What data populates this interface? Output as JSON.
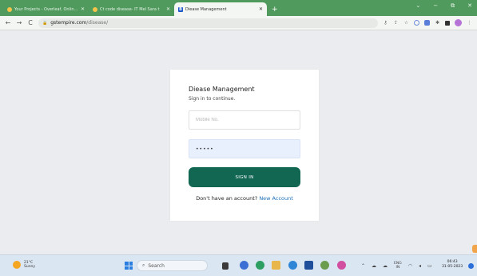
{
  "tabs": [
    {
      "label": "Your Projects - Overleaf, Online L"
    },
    {
      "label": "Ct code disease- IT Mel Sara t"
    },
    {
      "label": "Diease Management"
    }
  ],
  "new_tab_label": "+",
  "window_controls": [
    "⌄",
    "−",
    "⧉",
    "✕"
  ],
  "address": {
    "host": "gstempire.com",
    "path": "/disease/"
  },
  "nav": {
    "back": "←",
    "forward": "→",
    "reload": "C"
  },
  "card": {
    "title": "Diease Management",
    "subtitle": "Sign in to continue.",
    "mobile_placeholder": "Mobile No.",
    "password_value": "•••••",
    "signin_label": "SIGN IN",
    "account_prompt": "Don't have an account?",
    "new_account_link": "New Account"
  },
  "colors": {
    "primary": "#126753",
    "link": "#1d6fb8",
    "tabstrip": "#4f9a5c"
  },
  "taskbar": {
    "weather_temp": "21°C",
    "weather_desc": "Sunny",
    "search_label": "Search",
    "lang_top": "ENG",
    "lang_bottom": "IN",
    "time": "06:43",
    "date": "31-05-2023"
  }
}
